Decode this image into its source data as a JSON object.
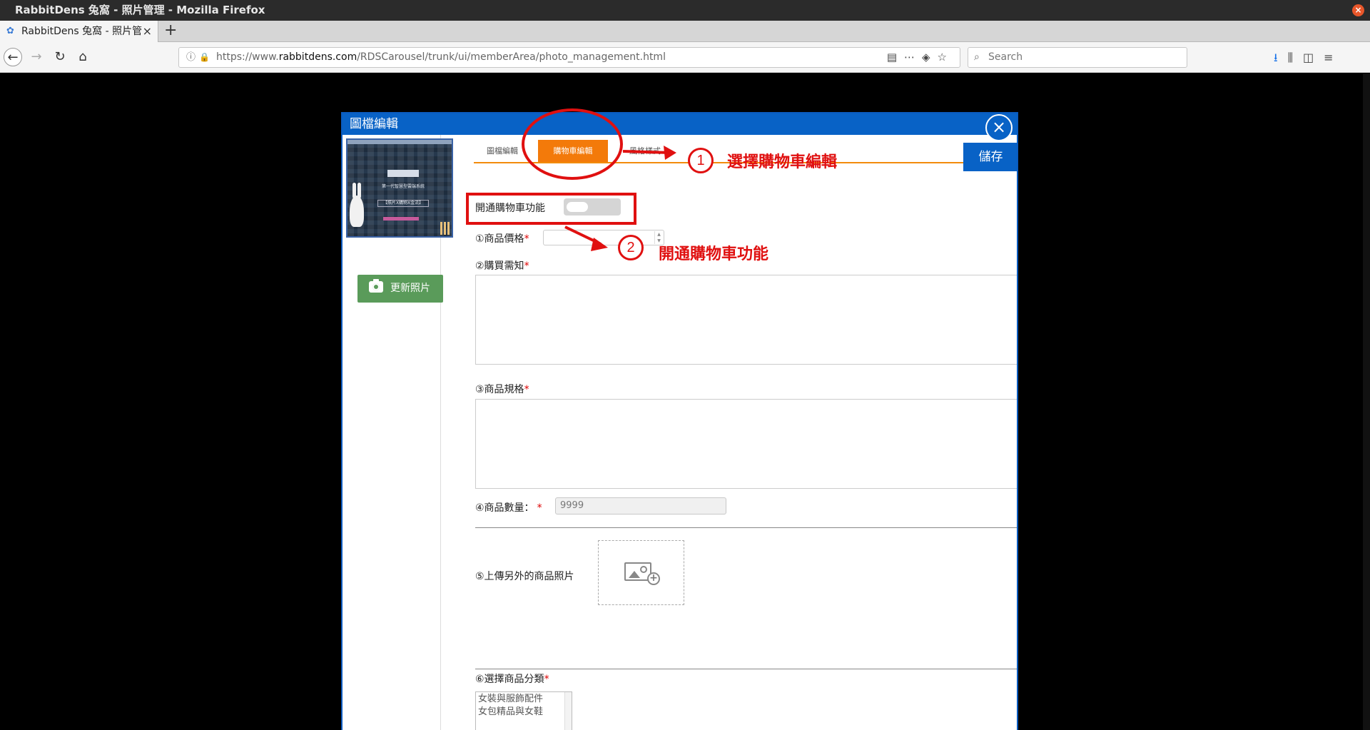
{
  "window": {
    "title": "RabbitDens 兔窩 - 照片管理 - Mozilla Firefox",
    "close_glyph": "×"
  },
  "browser": {
    "tab_title": "RabbitDens 兔窩 - 照片管",
    "tab_close": "×",
    "new_tab": "+",
    "url_prefix": "https://www.",
    "url_host": "rabbitdens.com",
    "url_path": "/RDSCarousel/trunk/ui/memberArea/photo_management.html",
    "search_placeholder": "Search",
    "icons": [
      "info-icon",
      "lock-icon",
      "reader-view-icon",
      "page-actions-icon",
      "pocket-icon",
      "bookmark-star-icon",
      "download-icon",
      "library-icon",
      "sidebar-icon",
      "menu-icon"
    ]
  },
  "modal": {
    "title": "圖檔編輯",
    "close_glyph": "×",
    "refresh_photo_label": "更新照片",
    "save_label": "儲存",
    "tabs": [
      {
        "label": "圖檔編輯",
        "active": false
      },
      {
        "label": "購物車編輯",
        "active": true
      },
      {
        "label": "風格樣式",
        "active": false
      }
    ],
    "form": {
      "enable_cart_label": "開通購物車功能",
      "enable_cart_on": false,
      "price_label": "①商品價格",
      "notice_label": "②購買需知",
      "spec_label": "③商品規格",
      "quantity_label": "④商品數量：",
      "quantity_placeholder": "9999",
      "upload_label": "⑤上傳另外的商品照片",
      "category_label": "⑥選擇商品分類",
      "required_mark": "*",
      "categories": [
        "女裝與服飾配件",
        "女包精品與女鞋"
      ]
    },
    "thumbnail": {
      "line1": "第一代智慧型雲端系統",
      "line2": "【照片X購物X金流】"
    }
  },
  "annotations": {
    "step1_number": "1",
    "step1_text": "選擇購物車編輯",
    "step2_number": "2",
    "step2_text": "開通購物車功能",
    "color": "#e01010"
  },
  "colors": {
    "modal_blue": "#0862c6",
    "tab_orange": "#f37a0a",
    "refresh_green": "#5a9b5a"
  }
}
